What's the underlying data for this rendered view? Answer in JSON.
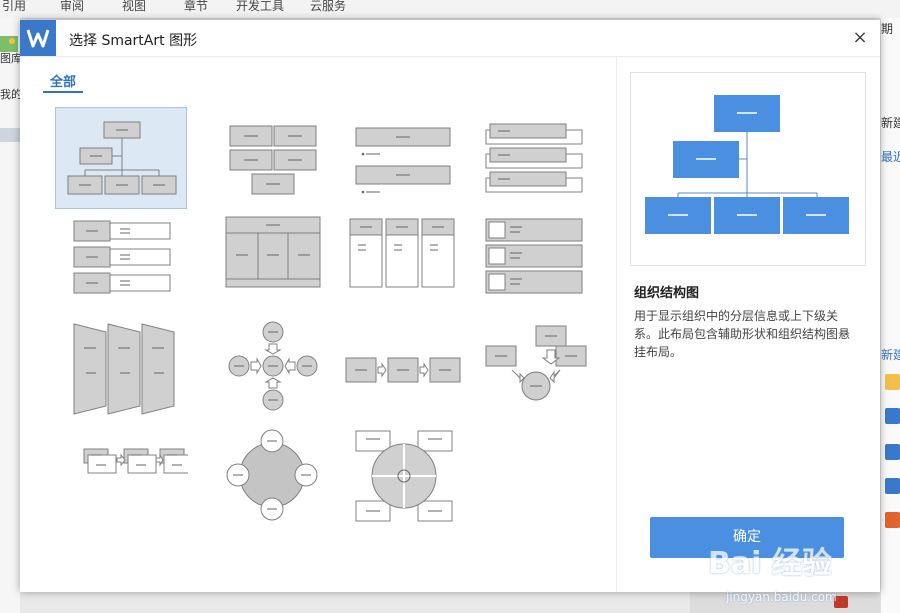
{
  "ribbon_tabs": [
    "引用",
    "审阅",
    "视图",
    "章节",
    "开发工具",
    "云服务"
  ],
  "bg_left": {
    "label1": "图库",
    "label2": "我的"
  },
  "bg_right": {
    "label1": "期",
    "label2": "新建",
    "label3": "最近",
    "label4": "新建"
  },
  "dialog": {
    "title": "选择 SmartArt 图形",
    "logo_icon": "wps-logo-icon",
    "close": "×",
    "tab": "全部",
    "preview_title": "组织结构图",
    "preview_desc": "用于显示组织中的分层信息或上下级关系。此布局包含辅助形状和组织结构图悬挂布局。",
    "ok_button": "确定",
    "dash": "—",
    "gallery_items": [
      {
        "name": "organization-chart",
        "selected": true
      },
      {
        "name": "basic-block-list"
      },
      {
        "name": "vertical-bullet-list"
      },
      {
        "name": "stacked-list"
      },
      {
        "name": "vertical-box-list"
      },
      {
        "name": "table-hierarchy"
      },
      {
        "name": "column-list"
      },
      {
        "name": "picture-list"
      },
      {
        "name": "trapezoid-list"
      },
      {
        "name": "radial-arrows"
      },
      {
        "name": "basic-process"
      },
      {
        "name": "converging-arrows"
      },
      {
        "name": "step-process"
      },
      {
        "name": "basic-cycle"
      },
      {
        "name": "cycle-matrix"
      }
    ]
  },
  "watermark": {
    "text": "Bai 经验",
    "url": "jingyan.baidu.com"
  },
  "colors": {
    "accent": "#3a78c9",
    "shape_fill": "#d0d0d0",
    "shape_stroke": "#808080",
    "preview_fill": "#4a8fe0"
  }
}
